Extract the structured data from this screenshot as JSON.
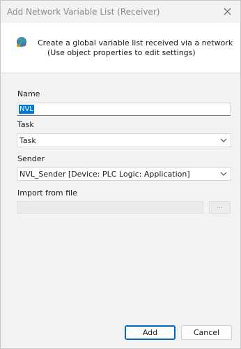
{
  "window": {
    "title": "Add Network Variable List (Receiver)"
  },
  "header": {
    "line1": "Create a global variable list received via a network",
    "line2": "(Use object properties to edit settings)"
  },
  "form": {
    "name": {
      "label": "Name",
      "value": "NVL"
    },
    "task": {
      "label": "Task",
      "value": "Task"
    },
    "sender": {
      "label": "Sender",
      "value": "NVL_Sender [Device: PLC Logic: Application]"
    },
    "import": {
      "label": "Import from file",
      "value": "",
      "browse_label": "..."
    }
  },
  "buttons": {
    "add": "Add",
    "cancel": "Cancel"
  },
  "colors": {
    "accent": "#0078d7",
    "primary_border": "#0067c0"
  }
}
